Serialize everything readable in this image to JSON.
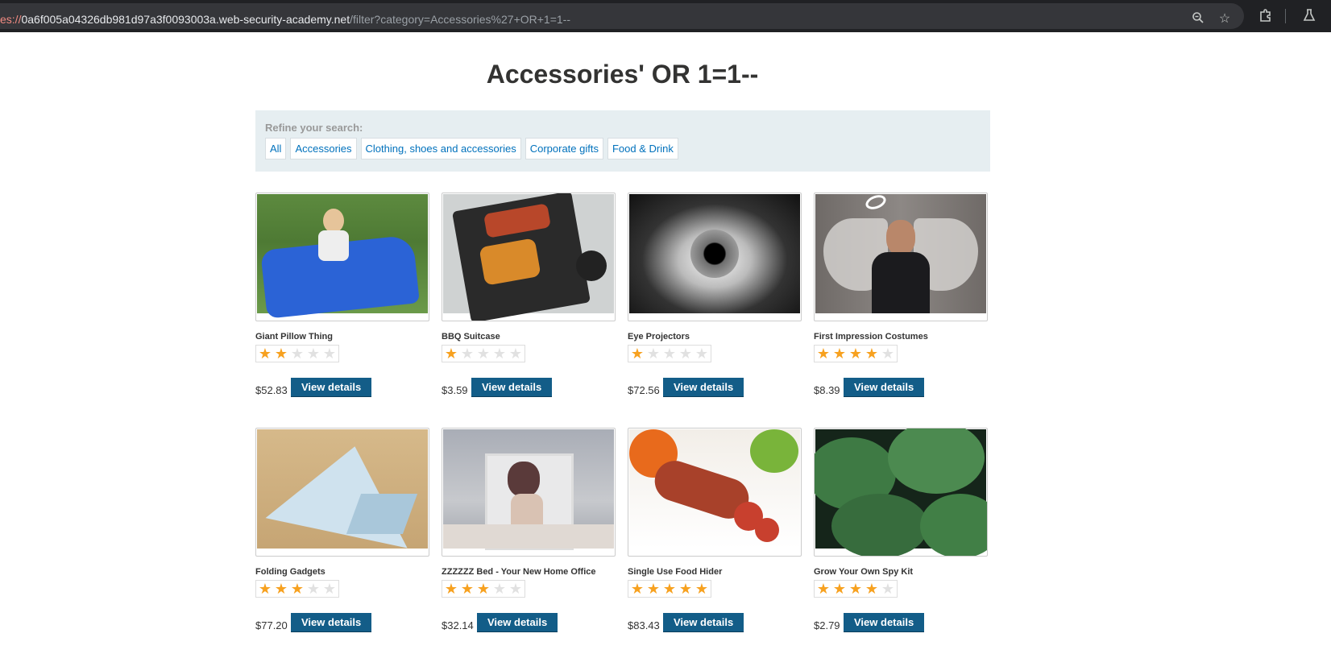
{
  "browser": {
    "url_scheme": "es://",
    "url_host": "0a6f005a04326db981d97a3f0093003a.web-security-academy.net",
    "url_path": "/filter?category=Accessories%27+OR+1=1--"
  },
  "page": {
    "title": "Accessories' OR 1=1--",
    "refine_label": "Refine your search:",
    "categories": [
      "All",
      "Accessories",
      "Clothing, shoes and accessories",
      "Corporate gifts",
      "Food & Drink"
    ]
  },
  "colors": {
    "accent": "#135d88",
    "link": "#0071bc",
    "star": "#f7a11f"
  },
  "products": [
    {
      "name": "Giant Pillow Thing",
      "rating": 2,
      "price": "$52.83",
      "button": "View details",
      "image": "blue-beanbag-girl"
    },
    {
      "name": "BBQ Suitcase",
      "rating": 1,
      "price": "$3.59",
      "button": "View details",
      "image": "bbq-grill"
    },
    {
      "name": "Eye Projectors",
      "rating": 1,
      "price": "$72.56",
      "button": "View details",
      "image": "eye-closeup"
    },
    {
      "name": "First Impression Costumes",
      "rating": 4,
      "price": "$8.39",
      "button": "View details",
      "image": "angel-man"
    },
    {
      "name": "Folding Gadgets",
      "rating": 3,
      "price": "$77.20",
      "button": "View details",
      "image": "paper-origami"
    },
    {
      "name": "ZZZZZZ Bed - Your New Home Office",
      "rating": 3,
      "price": "$32.14",
      "button": "View details",
      "image": "woman-flying-books"
    },
    {
      "name": "Single Use Food Hider",
      "rating": 5,
      "price": "$83.43",
      "button": "View details",
      "image": "sausage-banana"
    },
    {
      "name": "Grow Your Own Spy Kit",
      "rating": 4,
      "price": "$2.79",
      "button": "View details",
      "image": "green-leaves"
    }
  ]
}
